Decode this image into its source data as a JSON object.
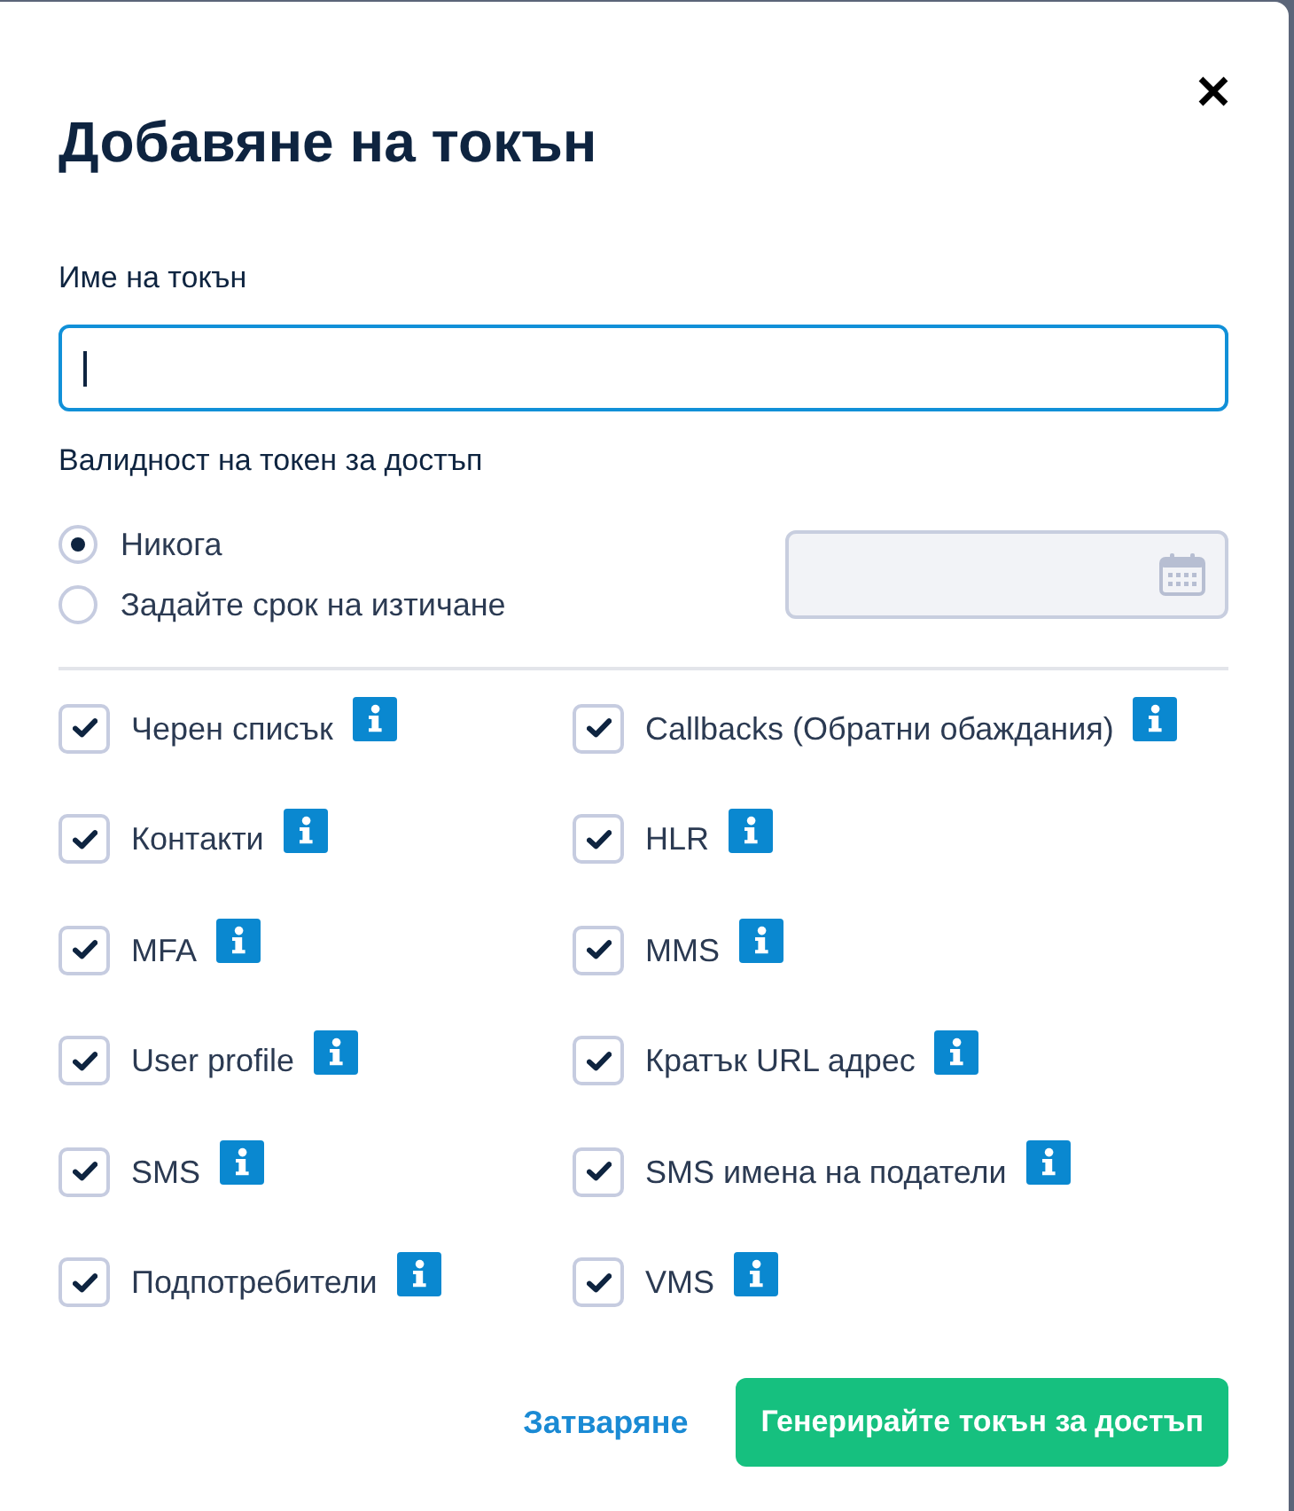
{
  "title": "Добавяне на токън",
  "token_name": {
    "label": "Име на токън",
    "focused": true
  },
  "validity": {
    "label": "Валидност на токен за достъп",
    "options": [
      {
        "label": "Никога",
        "selected": true
      },
      {
        "label": "Задайте срок на изтичане",
        "selected": false
      }
    ],
    "date_field": {
      "disabled": true
    }
  },
  "permissions": [
    {
      "label": "Черен списък",
      "checked": true
    },
    {
      "label": "Callbacks (Обратни обаждания)",
      "checked": true
    },
    {
      "label": "Контакти",
      "checked": true
    },
    {
      "label": "HLR",
      "checked": true
    },
    {
      "label": "MFA",
      "checked": true
    },
    {
      "label": "MMS",
      "checked": true
    },
    {
      "label": "User profile",
      "checked": true
    },
    {
      "label": "Кратък URL адрес",
      "checked": true
    },
    {
      "label": "SMS",
      "checked": true
    },
    {
      "label": "SMS имена на податели",
      "checked": true
    },
    {
      "label": "Подпотребители",
      "checked": true
    },
    {
      "label": "VMS",
      "checked": true
    }
  ],
  "footer": {
    "close_link": "Затваряне",
    "submit_button": "Генерирайте токън за достъп"
  }
}
